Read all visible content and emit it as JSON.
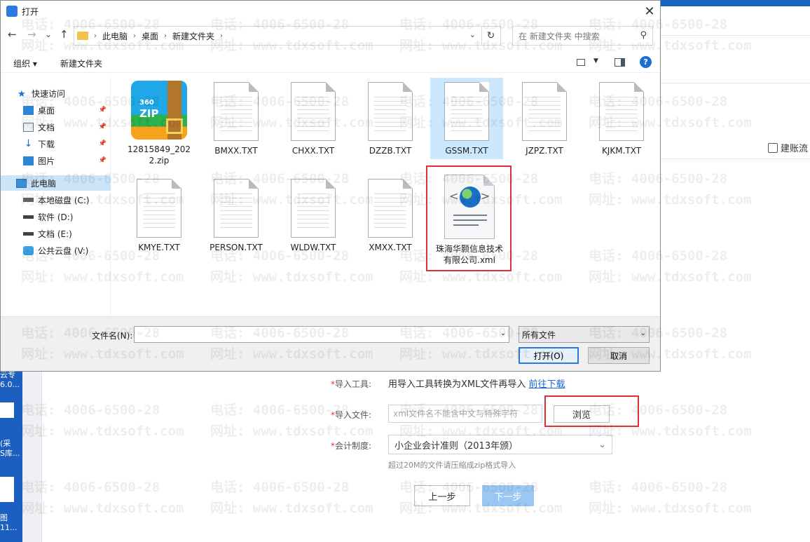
{
  "watermark": {
    "phone": "电话: 4006-6500-28",
    "site": "网址: www.tdxsoft.com"
  },
  "dialog": {
    "title": "打开",
    "close_label": "✕",
    "nav": {
      "back": "←",
      "forward": "→",
      "recent": "⌄",
      "up": "↑",
      "breadcrumb": [
        "此电脑",
        "桌面",
        "新建文件夹"
      ],
      "search_placeholder": "在 新建文件夹 中搜索"
    },
    "toolbar": {
      "organize": "组织 ▾",
      "new_folder": "新建文件夹"
    },
    "sidebar": [
      {
        "label": "快速访问",
        "icon": "star-icon"
      },
      {
        "label": "桌面",
        "icon": "desktop-icon",
        "pinned": true
      },
      {
        "label": "文档",
        "icon": "document-icon",
        "pinned": true
      },
      {
        "label": "下载",
        "icon": "download-icon",
        "pinned": true
      },
      {
        "label": "图片",
        "icon": "picture-icon",
        "pinned": true
      },
      {
        "label": "此电脑",
        "icon": "computer-icon",
        "selected": true
      },
      {
        "label": "本地磁盘 (C:)",
        "icon": "drive-icon"
      },
      {
        "label": "软件 (D:)",
        "icon": "drive-icon"
      },
      {
        "label": "文档 (E:)",
        "icon": "drive-icon"
      },
      {
        "label": "公共云盘 (V:)",
        "icon": "cloud-drive-icon"
      }
    ],
    "files": [
      {
        "name": "12815849_2022.zip",
        "type": "zip"
      },
      {
        "name": "BMXX.TXT",
        "type": "txt"
      },
      {
        "name": "CHXX.TXT",
        "type": "txt"
      },
      {
        "name": "DZZB.TXT",
        "type": "txt"
      },
      {
        "name": "GSSM.TXT",
        "type": "txt",
        "selected": true
      },
      {
        "name": "JZPZ.TXT",
        "type": "txt"
      },
      {
        "name": "KJKM.TXT",
        "type": "txt"
      },
      {
        "name": "KMYE.TXT",
        "type": "txt"
      },
      {
        "name": "PERSON.TXT",
        "type": "txt"
      },
      {
        "name": "WLDW.TXT",
        "type": "txt"
      },
      {
        "name": "XMXX.TXT",
        "type": "txt"
      },
      {
        "name": "珠海华颢信息技术有限公司.xml",
        "type": "xml",
        "highlighted": true
      }
    ],
    "zip_icon_text": {
      "brand": "360",
      "ext": "ZIP"
    },
    "filename_label": "文件名(N):",
    "filename_value": "",
    "filetype_value": "所有文件",
    "open_button": "打开(O)",
    "cancel_button": "取消"
  },
  "background": {
    "flow_label": "建账流",
    "desktop_items": [
      "云专",
      "6.0...",
      "(采",
      "S库...",
      "图",
      "11..."
    ],
    "form": {
      "tool_label": "导入工具:",
      "tool_text": "用导入工具转换为XML文件再导入",
      "tool_link": "前往下载",
      "file_label": "导入文件:",
      "file_placeholder": "xml文件名不能含中文与特殊字符",
      "browse_button": "浏览",
      "acct_label": "会计制度:",
      "acct_value": "小企业会计准则（2013年颁）",
      "size_hint": "超过20M的文件请压缩成zip格式导入",
      "prev_button": "上一步",
      "next_button": "下一步"
    }
  },
  "colors": {
    "highlight_red": "#e0303a",
    "link_blue": "#1a66d2",
    "primary_disabled": "#9cc7f5",
    "selection": "#cce4f7"
  }
}
